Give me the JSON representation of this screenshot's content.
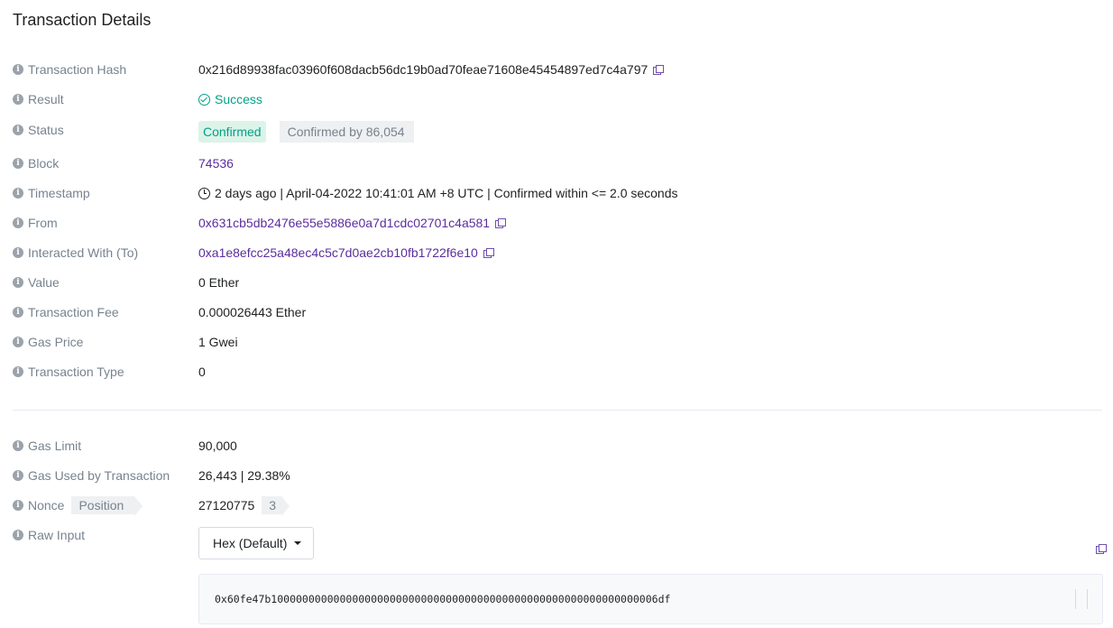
{
  "page_title": "Transaction Details",
  "fields": {
    "tx_hash": {
      "label": "Transaction Hash",
      "value": "0x216d89938fac03960f608dacb56dc19b0ad70feae71608e45454897ed7c4a797"
    },
    "result": {
      "label": "Result",
      "value": "Success"
    },
    "status": {
      "label": "Status",
      "badge": "Confirmed",
      "confirmations": "Confirmed by 86,054"
    },
    "block": {
      "label": "Block",
      "value": "74536"
    },
    "timestamp": {
      "label": "Timestamp",
      "value": "2 days ago | April-04-2022 10:41:01 AM +8 UTC | Confirmed within <= 2.0 seconds"
    },
    "from": {
      "label": "From",
      "value": "0x631cb5db2476e55e5886e0a7d1cdc02701c4a581"
    },
    "to": {
      "label": "Interacted With (To)",
      "value": "0xa1e8efcc25a48ec4c5c7d0ae2cb10fb1722f6e10"
    },
    "value": {
      "label": "Value",
      "value": "0 Ether"
    },
    "fee": {
      "label": "Transaction Fee",
      "value": "0.000026443 Ether"
    },
    "gas_price": {
      "label": "Gas Price",
      "value": "1 Gwei"
    },
    "tx_type": {
      "label": "Transaction Type",
      "value": "0"
    },
    "gas_limit": {
      "label": "Gas Limit",
      "value": "90,000"
    },
    "gas_used": {
      "label": "Gas Used by Transaction",
      "value": "26,443 | 29.38%"
    },
    "nonce": {
      "label": "Nonce",
      "position_label": "Position",
      "value": "27120775",
      "position": "3"
    },
    "raw_input": {
      "label": "Raw Input",
      "format_selected": "Hex (Default)",
      "data": "0x60fe47b10000000000000000000000000000000000000000000000000000000000006df"
    }
  },
  "colors": {
    "link": "#5b2d9e",
    "success": "#00a186",
    "label": "#77838f"
  },
  "icons": [
    "info-icon",
    "copy-icon",
    "check-circle-icon",
    "clock-icon",
    "caret-down-icon"
  ]
}
